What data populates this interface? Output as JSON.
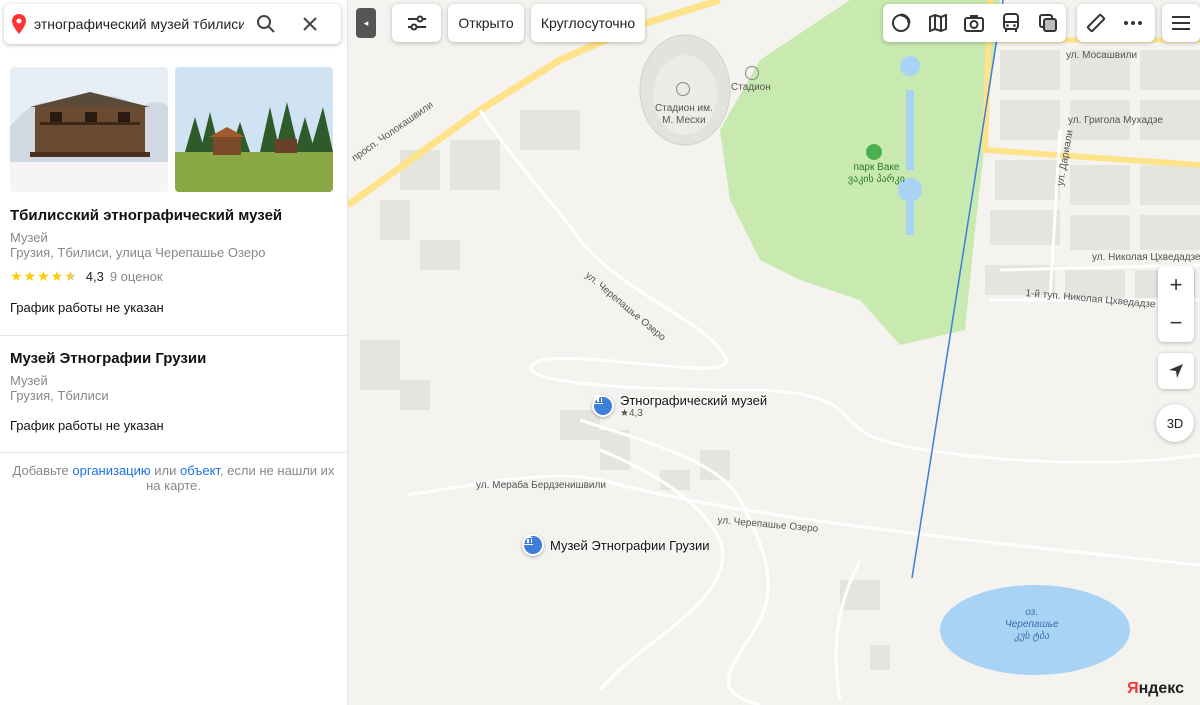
{
  "search": {
    "value": "этнографический музей тбилиси",
    "search_icon": "search-icon",
    "close_icon": "close-icon"
  },
  "results": [
    {
      "title": "Тбилисский этнографический музей",
      "category": "Музей",
      "address": "Грузия, Тбилиси, улица Черепашье Озеро",
      "rating_value": "4,3",
      "rating_stars": 4.5,
      "reviews": "9 оценок",
      "hours": "График работы не указан"
    },
    {
      "title": "Музей Этнографии Грузии",
      "category": "Музей",
      "address": "Грузия, Тбилиси",
      "hours": "График работы не указан"
    }
  ],
  "add_hint": {
    "prefix": "Добавьте ",
    "link_org": "организацию",
    "middle": " или ",
    "link_obj": "объект",
    "suffix": ", если не нашли их на карте."
  },
  "toolbar": {
    "collapse": "◂",
    "filter_open": "Открыто",
    "filter_24h": "Круглосуточно"
  },
  "controls": {
    "zoom_in": "+",
    "zoom_out": "−",
    "btn_3d": "3D",
    "logo_first": "Я",
    "logo_rest": "ндекс"
  },
  "map": {
    "streets": [
      "просп. Чолокашвили",
      "ул. Черепашье Озеро",
      "ул. Мераба Бердзенишвили",
      "ул. Черепашье Озеро",
      "ул. Мосашвили",
      "ул. Григола Мухадзе",
      "ул. Дариали",
      "ул. Николая Цхведадзе",
      "1-й туп. Николая Цхведадзе"
    ],
    "stadium": [
      "Стадион им.",
      "М. Месхи"
    ],
    "stadium2": "Стадион",
    "park": [
      "парк Ваке",
      "ვაკის პარკი"
    ],
    "lake": [
      "оз.",
      "Черепашье",
      "კუს ტბა"
    ],
    "poi_main": "Этнографический музей",
    "poi_main_rating": "★4,3",
    "poi_second": "Музей Этнографии Грузии"
  },
  "colors": {
    "accent": "#3d7fd9",
    "park": "#c8e9b0",
    "water": "#a8d3f5",
    "road_major": "#ffe38a",
    "star": "#ffcc00",
    "link": "#1a73e8"
  }
}
